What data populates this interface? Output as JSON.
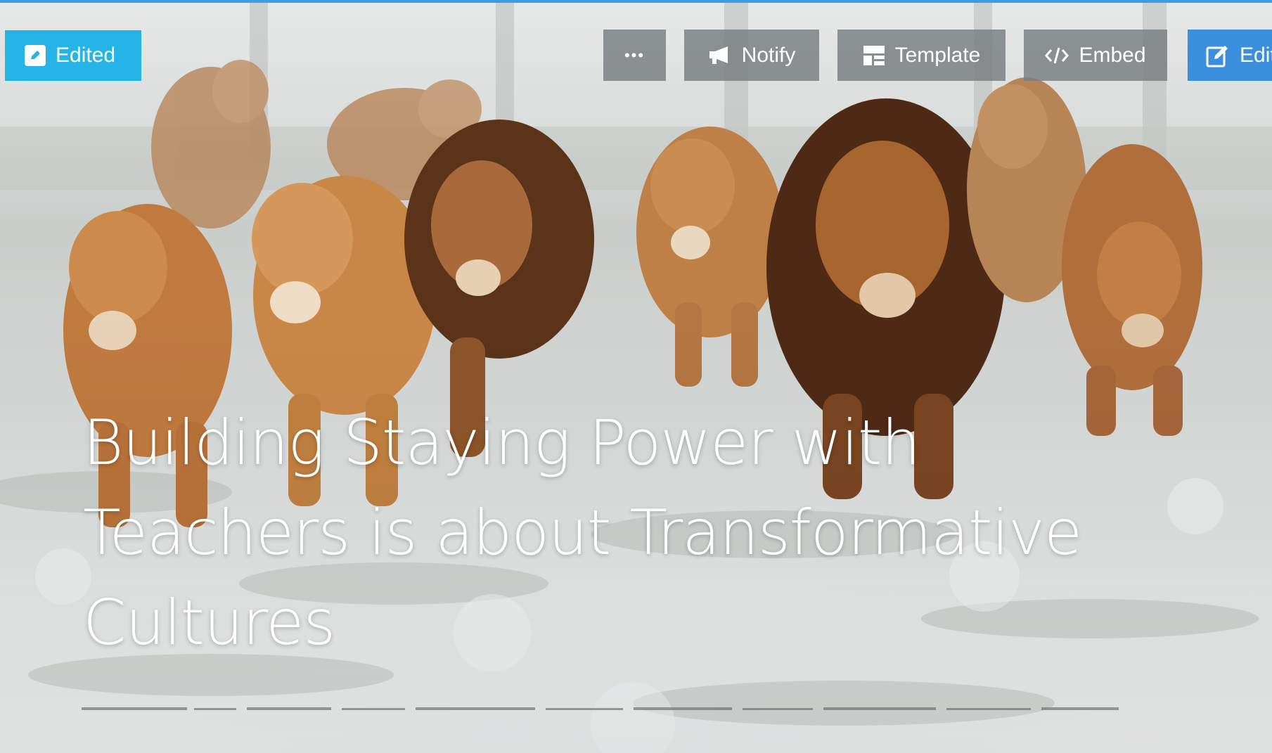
{
  "badge": {
    "label": "Edited",
    "icon": "pencil-square-icon"
  },
  "toolbar": {
    "more_label": "•••",
    "notify_label": "Notify",
    "template_label": "Template",
    "embed_label": "Embed",
    "edit_label": "Edit"
  },
  "hero": {
    "title_lines": [
      "Building Staying Power with",
      "Teachers is about Transformative",
      "Cultures"
    ]
  },
  "colors": {
    "badge": "#26b4e6",
    "edit_button": "#3b8fdc",
    "toolbar_button": "#787c80",
    "accent": "#3b9be3"
  }
}
